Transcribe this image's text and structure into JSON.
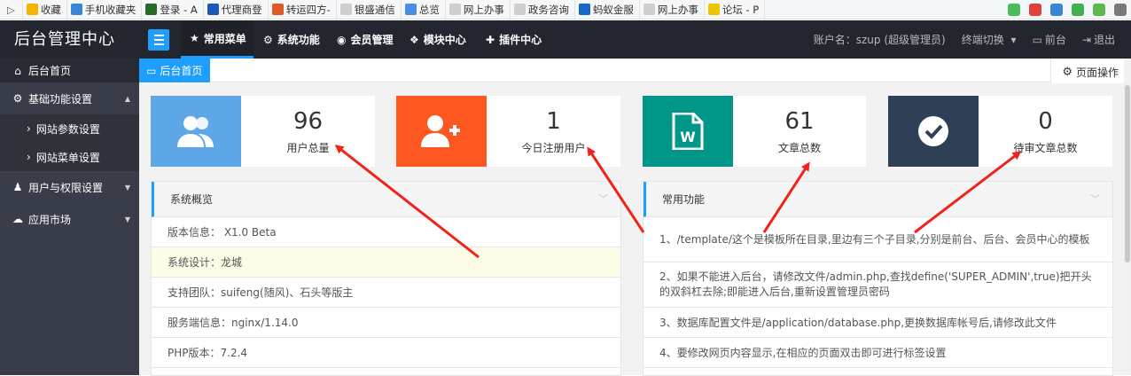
{
  "bookmarks": [
    {
      "label": "收藏",
      "icon": "star-icon",
      "color": "#f5b400"
    },
    {
      "label": "手机收藏夹",
      "icon": "phone-icon",
      "color": "#3a86d6"
    },
    {
      "label": "登录 - A",
      "icon": "site-icon",
      "color": "#2a6a2a"
    },
    {
      "label": "代理商登",
      "icon": "site-icon",
      "color": "#1c58b8"
    },
    {
      "label": "转运四方-",
      "icon": "site-icon",
      "color": "#e05a28"
    },
    {
      "label": "银盛通信",
      "icon": "page-icon",
      "color": "#cfcfcf"
    },
    {
      "label": "总览",
      "icon": "cloud-icon",
      "color": "#4a8ee0"
    },
    {
      "label": "网上办事",
      "icon": "page-icon",
      "color": "#cfcfcf"
    },
    {
      "label": "政务咨询",
      "icon": "page-icon",
      "color": "#cfcfcf"
    },
    {
      "label": "蚂蚁金服",
      "icon": "ant-icon",
      "color": "#1a66c8"
    },
    {
      "label": "网上办事",
      "icon": "page-icon",
      "color": "#cfcfcf"
    },
    {
      "label": "论坛 - P",
      "icon": "smile-icon",
      "color": "#f0c400"
    }
  ],
  "header": {
    "title": "后台管理中心",
    "nav": [
      {
        "label": "常用菜单",
        "icon": "star-icon"
      },
      {
        "label": "系统功能",
        "icon": "gear-icon"
      },
      {
        "label": "会员管理",
        "icon": "user-circle-icon"
      },
      {
        "label": "模块中心",
        "icon": "cubes-icon"
      },
      {
        "label": "插件中心",
        "icon": "puzzle-icon"
      }
    ],
    "account": "账户名：szup (超级管理员)",
    "switch": "终端切换",
    "front": "前台",
    "logout": "退出"
  },
  "sidebar": {
    "home": "后台首页",
    "basic": "基础功能设置",
    "site_params": "网站参数设置",
    "site_menu": "网站菜单设置",
    "users": "用户与权限设置",
    "market": "应用市场"
  },
  "tabs": {
    "home": "后台首页",
    "page_ops": "页面操作"
  },
  "stats": [
    {
      "value": "96",
      "label": "用户总量",
      "color": "#5fa8e8"
    },
    {
      "value": "1",
      "label": "今日注册用户",
      "color": "#ff5722"
    },
    {
      "value": "61",
      "label": "文章总数",
      "color": "#009688"
    },
    {
      "value": "0",
      "label": "待审文章总数",
      "color": "#2f4056"
    }
  ],
  "overview": {
    "title": "系统概览",
    "rows": [
      "版本信息： X1.0 Beta",
      "系统设计：龙城",
      "支持团队：suifeng(随风)、石头等版主",
      "服务端信息：nginx/1.14.0",
      "PHP版本：7.2.4"
    ]
  },
  "functions": {
    "title": "常用功能",
    "rows": [
      "1、/template/这个是模板所在目录,里边有三个子目录,分别是前台、后台、会员中心的模板",
      "2、如果不能进入后台，请修改文件/admin.php,查找define('SUPER_ADMIN',true)把开头的双斜杠去除;即能进入后台,重新设置管理员密码",
      "3、数据库配置文件是/application/database.php,更换数据库帐号后,请修改此文件",
      "4、要修改网页内容显示,在相应的页面双击即可进行标签设置"
    ]
  },
  "colors": {
    "accent": "#1e9fff",
    "header_bg": "#23262e",
    "sidebar_bg": "#393d49",
    "arrow": "#f0221a"
  }
}
